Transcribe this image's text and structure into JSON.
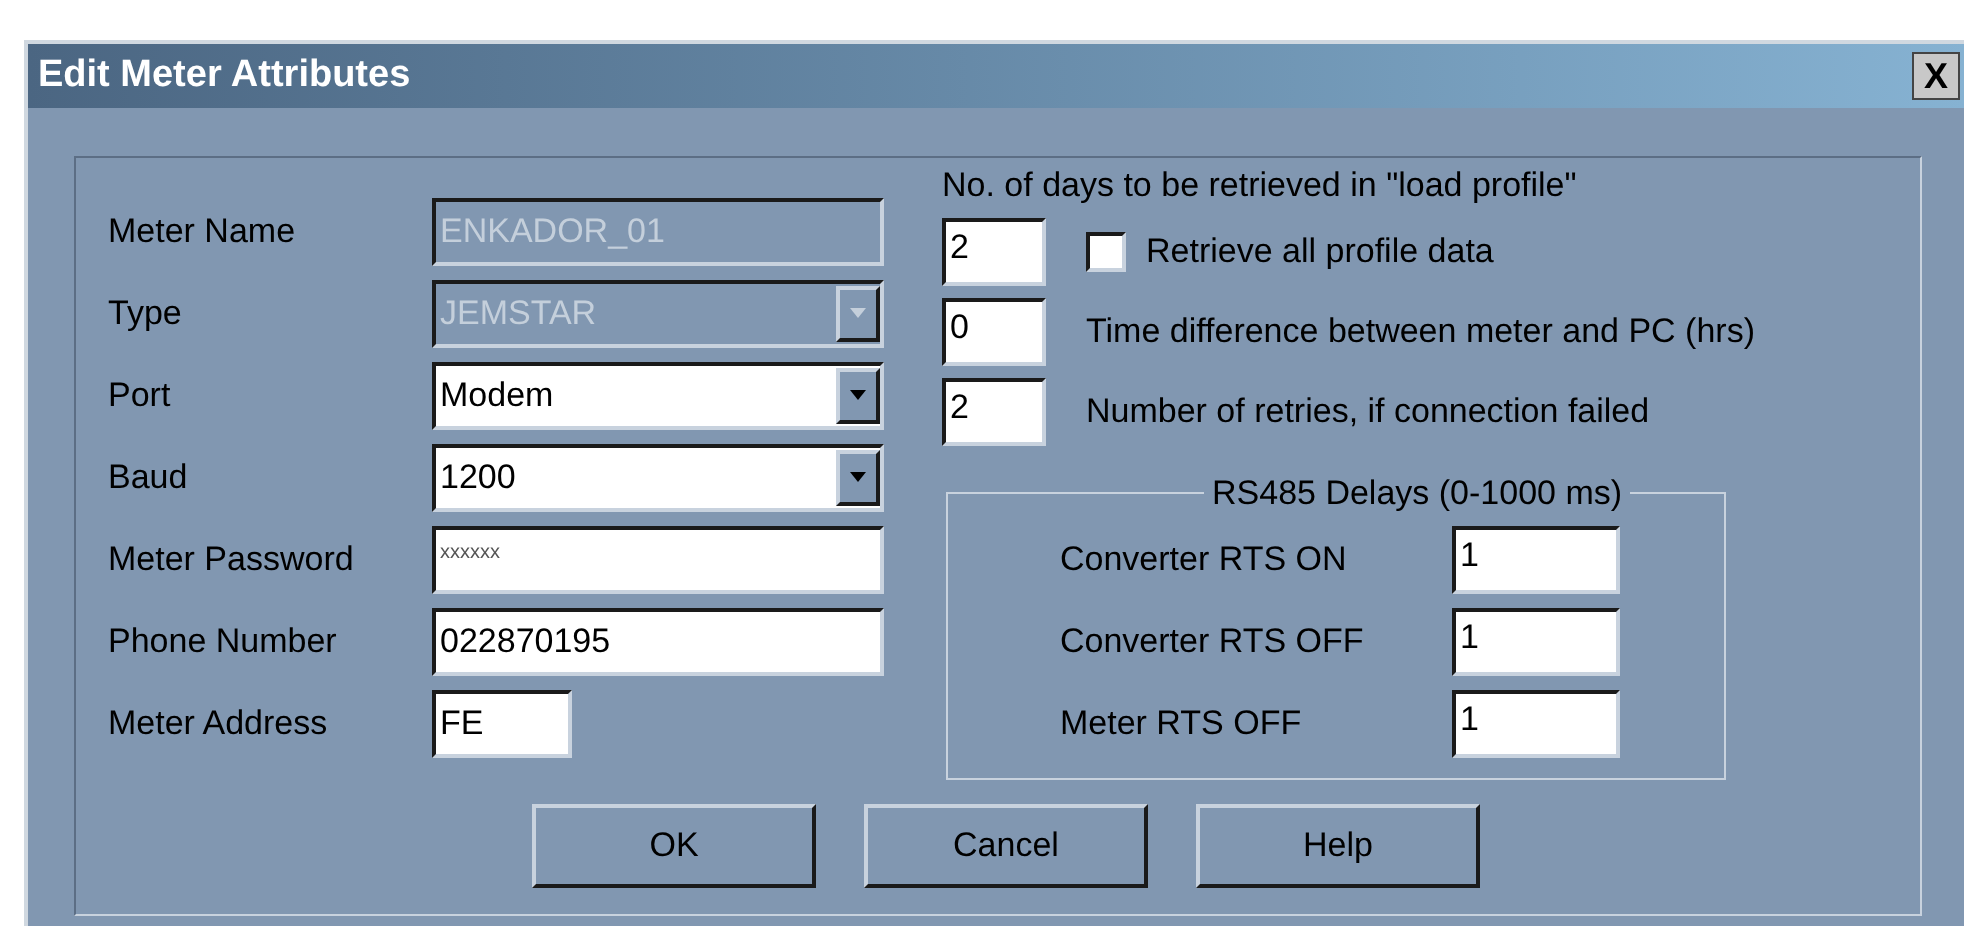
{
  "window": {
    "title": "Edit Meter Attributes",
    "close": "X"
  },
  "fields": [
    {
      "kind": "text",
      "label": "Meter Name",
      "value": "ENKADOR_01",
      "disabled": true
    },
    {
      "kind": "select",
      "label": "Type",
      "value": "JEMSTAR",
      "disabled": true
    },
    {
      "kind": "select",
      "label": "Port",
      "value": "Modem",
      "disabled": false
    },
    {
      "kind": "select",
      "label": "Baud",
      "value": "1200",
      "disabled": false
    },
    {
      "kind": "password",
      "label": "Meter Password",
      "value": "xxxxxx",
      "disabled": false
    },
    {
      "kind": "text",
      "label": "Phone Number",
      "value": "022870195",
      "disabled": false
    },
    {
      "kind": "short",
      "label": "Meter Address",
      "value": "FE",
      "disabled": false
    }
  ],
  "load_profile": {
    "heading": "No. of days to be retrieved in \"load profile\"",
    "rows": [
      {
        "value": "2",
        "label": "Retrieve all profile data",
        "kind": "checkbox",
        "checked": false
      },
      {
        "value": "0",
        "label": "Time difference between meter and PC (hrs)",
        "kind": "plain"
      },
      {
        "value": "2",
        "label": "Number of retries, if connection failed",
        "kind": "plain"
      }
    ]
  },
  "rs485": {
    "title": "RS485 Delays (0-1000 ms)",
    "rows": [
      {
        "label": "Converter RTS ON",
        "value": "1"
      },
      {
        "label": "Converter RTS OFF",
        "value": "1"
      },
      {
        "label": "Meter RTS OFF",
        "value": "1"
      }
    ]
  },
  "buttons": [
    "OK",
    "Cancel",
    "Help"
  ]
}
